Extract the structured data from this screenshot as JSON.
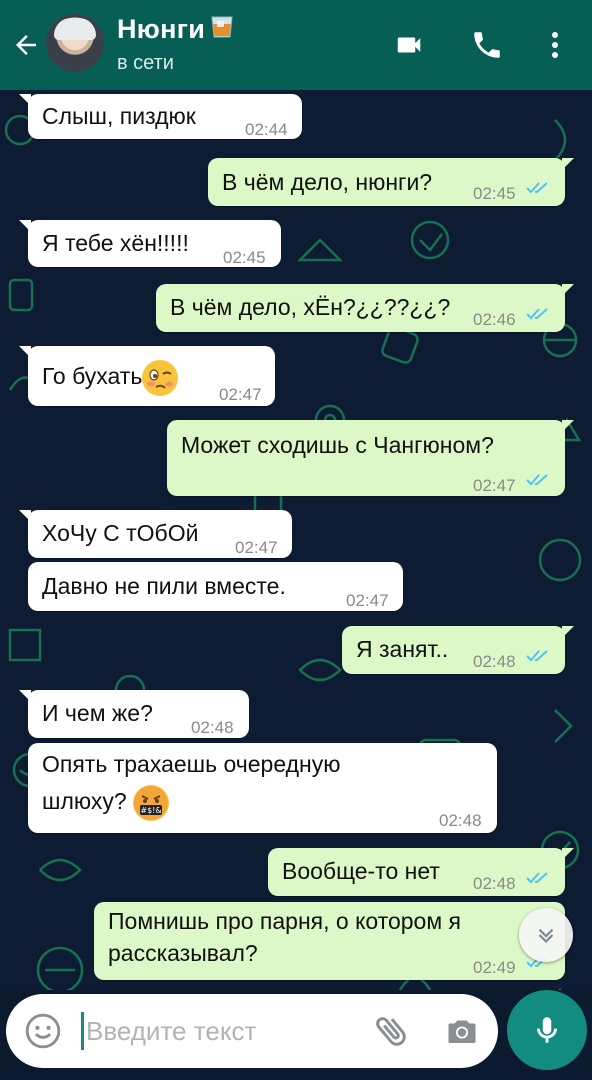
{
  "header": {
    "contact_name": "Нюнги",
    "status": "в сети"
  },
  "icons": {
    "back": "arrow-left-icon",
    "video": "video-call-icon",
    "call": "phone-icon",
    "menu": "more-vert-icon",
    "emoji": "emoji-icon",
    "attach": "paperclip-icon",
    "camera": "camera-icon",
    "mic": "microphone-icon",
    "scroll": "chevron-down-icon",
    "contact_emoji": "whisky-glass-icon"
  },
  "colors": {
    "header": "#075e54",
    "incoming_bubble": "#ffffff",
    "outgoing_bubble": "#dcf8c6",
    "read_ticks": "#4fc3f7",
    "accent": "#128c7e"
  },
  "messages": [
    {
      "dir": "in",
      "text": "Слыш, пиздюк",
      "time": "02:44"
    },
    {
      "dir": "out",
      "text": "В чём дело, нюнги?",
      "time": "02:45",
      "read": true
    },
    {
      "dir": "in",
      "text": "Я тебе хён!!!!!",
      "time": "02:45"
    },
    {
      "dir": "out",
      "text": "В чём дело, хЁн?¿¿??¿¿?",
      "time": "02:46",
      "read": true
    },
    {
      "dir": "in",
      "text": "Го бухать",
      "time": "02:47",
      "emoji": "woozy-face-emoji"
    },
    {
      "dir": "out",
      "text": "Может сходишь с Чангюном?",
      "time": "02:47",
      "read": true
    },
    {
      "dir": "in",
      "text": "ХоЧу С тОбОй",
      "time": "02:47"
    },
    {
      "dir": "in",
      "text": "Давно не пили вместе.",
      "time": "02:47"
    },
    {
      "dir": "out",
      "text": "Я занят..",
      "time": "02:48",
      "read": true
    },
    {
      "dir": "in",
      "text": "И чем же?",
      "time": "02:48"
    },
    {
      "dir": "in",
      "text_line1": "Опять трахаешь очередную",
      "text_line2": "шлюху?",
      "time": "02:48",
      "emoji": "cursing-face-emoji"
    },
    {
      "dir": "out",
      "text": "Вообще-то нет",
      "time": "02:48",
      "read": true
    },
    {
      "dir": "out",
      "text_line1": "Помнишь про парня, о котором я",
      "text_line2": "рассказывал?",
      "time": "02:49",
      "read": true
    }
  ],
  "composer": {
    "placeholder": "Введите текст",
    "value": ""
  }
}
